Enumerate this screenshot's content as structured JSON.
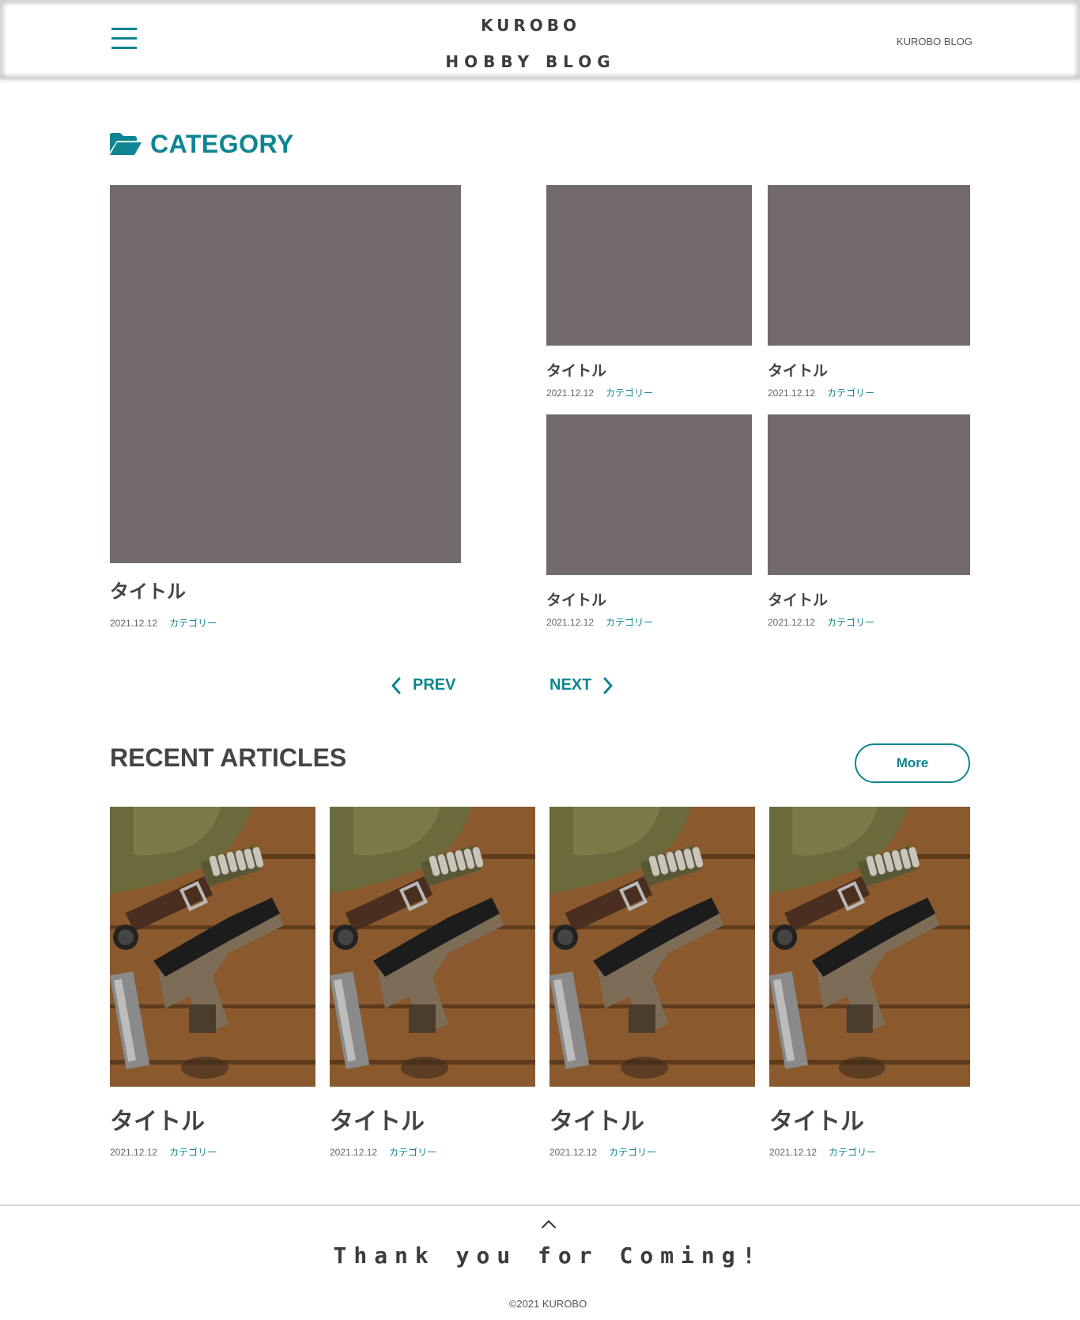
{
  "header": {
    "logo_line1": "KUROBO",
    "logo_line2": "HOBBY BLOG",
    "link": "KUROBO BLOG"
  },
  "category": {
    "heading": "CATEGORY",
    "main": {
      "title": "タイトル",
      "date": "2021.12.12",
      "category": "カテゴリー"
    },
    "grid": [
      {
        "title": "タイトル",
        "date": "2021.12.12",
        "category": "カテゴリー"
      },
      {
        "title": "タイトル",
        "date": "2021.12.12",
        "category": "カテゴリー"
      },
      {
        "title": "タイトル",
        "date": "2021.12.12",
        "category": "カテゴリー"
      },
      {
        "title": "タイトル",
        "date": "2021.12.12",
        "category": "カテゴリー"
      }
    ],
    "prev_label": "PREV",
    "next_label": "NEXT"
  },
  "recent": {
    "heading": "RECENT ARTICLES",
    "more_label": "More",
    "articles": [
      {
        "title": "タイトル",
        "date": "2021.12.12",
        "category": "カテゴリー"
      },
      {
        "title": "タイトル",
        "date": "2021.12.12",
        "category": "カテゴリー"
      },
      {
        "title": "タイトル",
        "date": "2021.12.12",
        "category": "カテゴリー"
      },
      {
        "title": "タイトル",
        "date": "2021.12.12",
        "category": "カテゴリー"
      }
    ]
  },
  "footer": {
    "thanks": "Thank you for Coming!",
    "copyright": "©2021 KUROBO"
  },
  "colors": {
    "accent": "#0e8591",
    "placeholder": "#736a6b",
    "text": "#444444"
  },
  "icons": [
    "hamburger-icon",
    "folder-open-icon",
    "chevron-left-icon",
    "chevron-right-icon",
    "chevron-up-icon"
  ]
}
